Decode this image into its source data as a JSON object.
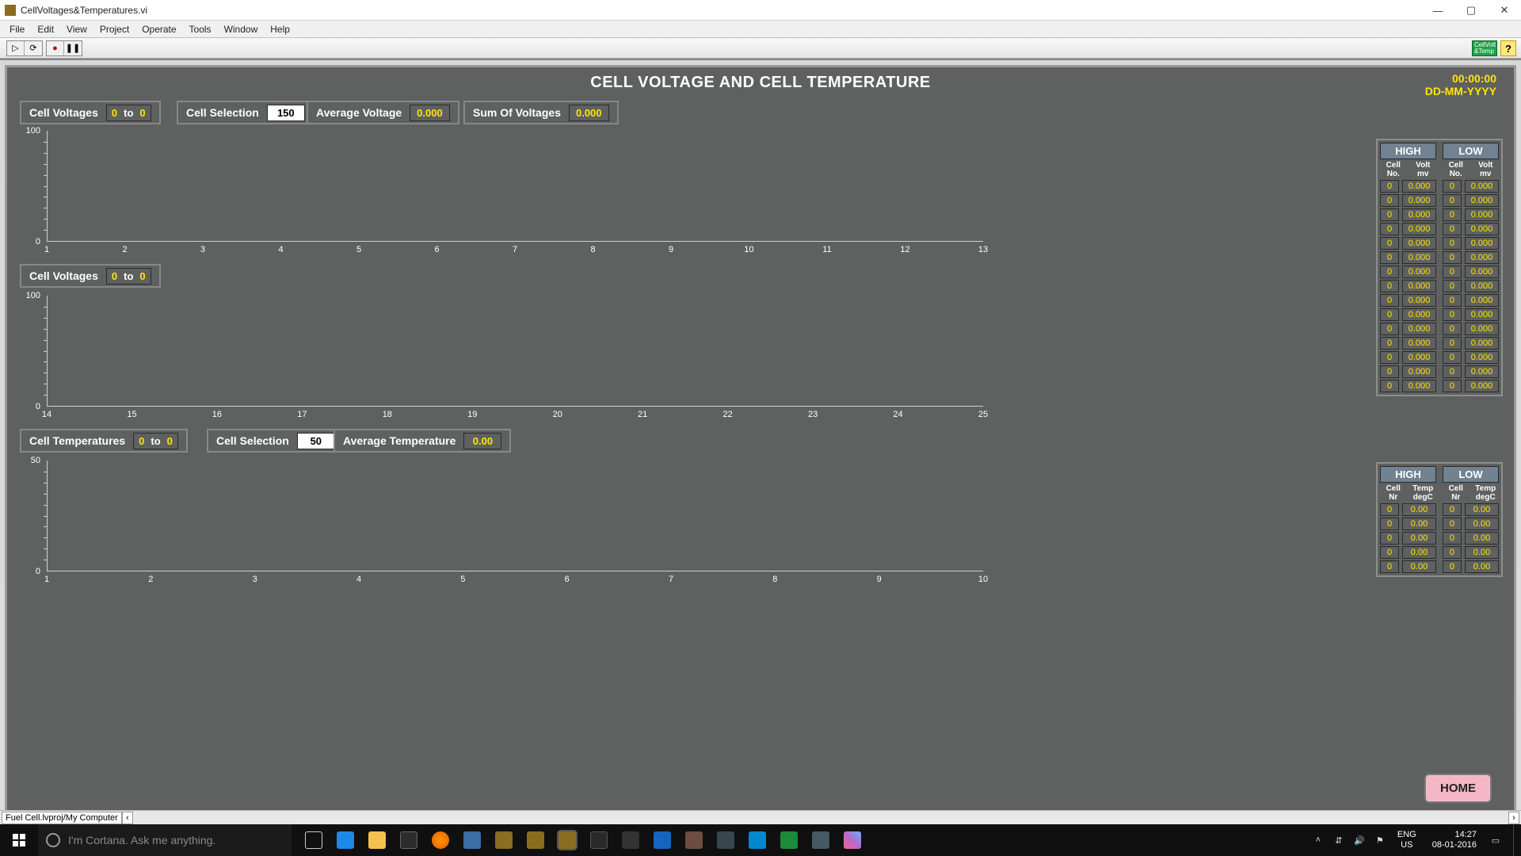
{
  "window": {
    "title": "CellVoltages&Temperatures.vi"
  },
  "menu": {
    "items": [
      "File",
      "Edit",
      "View",
      "Project",
      "Operate",
      "Tools",
      "Window",
      "Help"
    ]
  },
  "toolbar": {
    "run": "▷",
    "run_cont": "⟳",
    "abort": "●",
    "pause": "❚❚",
    "help": "?",
    "badge": "CellVolt\n&Temp"
  },
  "header": {
    "title": "CELL VOLTAGE AND CELL TEMPERATURE",
    "time": "00:00:00",
    "date": "DD-MM-YYYY"
  },
  "row1": {
    "cell_voltages_label": "Cell Voltages",
    "cell_voltages_from": "0",
    "range_sep": "to",
    "cell_voltages_to": "0",
    "cell_selection_label": "Cell Selection",
    "cell_selection_val": "150",
    "avg_voltage_label": "Average Voltage",
    "avg_voltage_val": "0.000",
    "sum_voltage_label": "Sum Of Voltages",
    "sum_voltage_val": "0.000"
  },
  "row2": {
    "cell_voltages_label": "Cell Voltages",
    "cell_voltages_from": "0",
    "range_sep": "to",
    "cell_voltages_to": "0"
  },
  "row3": {
    "cell_temps_label": "Cell Temperatures",
    "cell_temps_from": "0",
    "range_sep": "to",
    "cell_temps_to": "0",
    "cell_selection_label": "Cell Selection",
    "cell_selection_val": "50",
    "avg_temp_label": "Average Temperature",
    "avg_temp_val": "0.00"
  },
  "chart1": {
    "ymax": "100",
    "ymin": "0",
    "xticks": [
      "1",
      "2",
      "3",
      "4",
      "5",
      "6",
      "7",
      "8",
      "9",
      "10",
      "11",
      "12",
      "13"
    ]
  },
  "chart2": {
    "ymax": "100",
    "ymin": "0",
    "xticks": [
      "14",
      "15",
      "16",
      "17",
      "18",
      "19",
      "20",
      "21",
      "22",
      "23",
      "24",
      "25"
    ]
  },
  "chart3": {
    "ymax": "50",
    "ymin": "0",
    "xticks": [
      "1",
      "2",
      "3",
      "4",
      "5",
      "6",
      "7",
      "8",
      "9",
      "10"
    ]
  },
  "hl_volt": {
    "high": "HIGH",
    "low": "LOW",
    "cell_hdr": "Cell\nNo.",
    "val_hdr": "Volt\nmv",
    "rows_high": [
      [
        "0",
        "0.000"
      ],
      [
        "0",
        "0.000"
      ],
      [
        "0",
        "0.000"
      ],
      [
        "0",
        "0.000"
      ],
      [
        "0",
        "0.000"
      ],
      [
        "0",
        "0.000"
      ],
      [
        "0",
        "0.000"
      ],
      [
        "0",
        "0.000"
      ],
      [
        "0",
        "0.000"
      ],
      [
        "0",
        "0.000"
      ],
      [
        "0",
        "0.000"
      ],
      [
        "0",
        "0.000"
      ],
      [
        "0",
        "0.000"
      ],
      [
        "0",
        "0.000"
      ],
      [
        "0",
        "0.000"
      ]
    ],
    "rows_low": [
      [
        "0",
        "0.000"
      ],
      [
        "0",
        "0.000"
      ],
      [
        "0",
        "0.000"
      ],
      [
        "0",
        "0.000"
      ],
      [
        "0",
        "0.000"
      ],
      [
        "0",
        "0.000"
      ],
      [
        "0",
        "0.000"
      ],
      [
        "0",
        "0.000"
      ],
      [
        "0",
        "0.000"
      ],
      [
        "0",
        "0.000"
      ],
      [
        "0",
        "0.000"
      ],
      [
        "0",
        "0.000"
      ],
      [
        "0",
        "0.000"
      ],
      [
        "0",
        "0.000"
      ],
      [
        "0",
        "0.000"
      ]
    ]
  },
  "hl_temp": {
    "high": "HIGH",
    "low": "LOW",
    "cell_hdr": "Cell\nNr",
    "val_hdr": "Temp\ndegC",
    "rows_high": [
      [
        "0",
        "0.00"
      ],
      [
        "0",
        "0.00"
      ],
      [
        "0",
        "0.00"
      ],
      [
        "0",
        "0.00"
      ],
      [
        "0",
        "0.00"
      ]
    ],
    "rows_low": [
      [
        "0",
        "0.00"
      ],
      [
        "0",
        "0.00"
      ],
      [
        "0",
        "0.00"
      ],
      [
        "0",
        "0.00"
      ],
      [
        "0",
        "0.00"
      ]
    ]
  },
  "home": "HOME",
  "vi_path": "Fuel Cell.lvproj/My Computer",
  "taskbar": {
    "cortana": "I'm Cortana. Ask me anything.",
    "lang1": "ENG",
    "lang2": "US",
    "time": "14:27",
    "date": "08-01-2016"
  },
  "chart_data": [
    {
      "type": "bar",
      "title": "Cell Voltages 1-13",
      "categories": [
        "1",
        "2",
        "3",
        "4",
        "5",
        "6",
        "7",
        "8",
        "9",
        "10",
        "11",
        "12",
        "13"
      ],
      "values": [
        0,
        0,
        0,
        0,
        0,
        0,
        0,
        0,
        0,
        0,
        0,
        0,
        0
      ],
      "xlabel": "",
      "ylabel": "",
      "ylim": [
        0,
        100
      ]
    },
    {
      "type": "bar",
      "title": "Cell Voltages 14-25",
      "categories": [
        "14",
        "15",
        "16",
        "17",
        "18",
        "19",
        "20",
        "21",
        "22",
        "23",
        "24",
        "25"
      ],
      "values": [
        0,
        0,
        0,
        0,
        0,
        0,
        0,
        0,
        0,
        0,
        0,
        0
      ],
      "xlabel": "",
      "ylabel": "",
      "ylim": [
        0,
        100
      ]
    },
    {
      "type": "bar",
      "title": "Cell Temperatures 1-10",
      "categories": [
        "1",
        "2",
        "3",
        "4",
        "5",
        "6",
        "7",
        "8",
        "9",
        "10"
      ],
      "values": [
        0,
        0,
        0,
        0,
        0,
        0,
        0,
        0,
        0,
        0
      ],
      "xlabel": "",
      "ylabel": "",
      "ylim": [
        0,
        50
      ]
    }
  ]
}
